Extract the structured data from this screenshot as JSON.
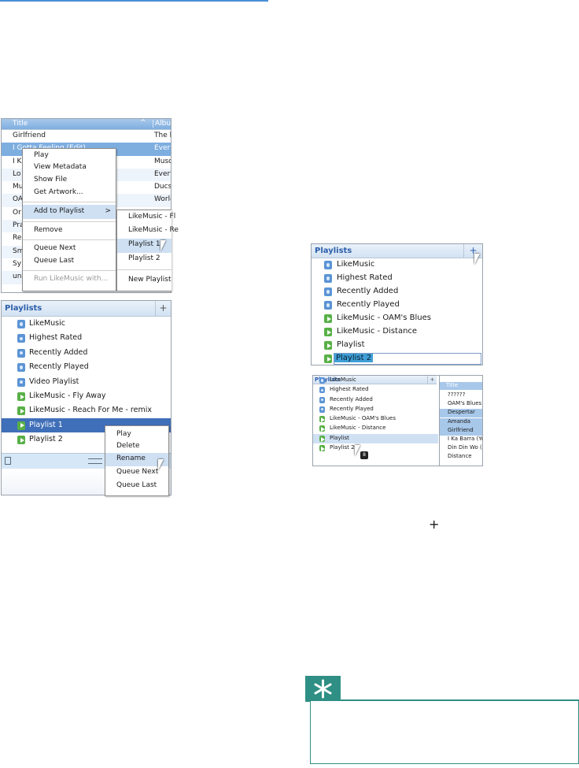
{
  "table_shot": {
    "header": {
      "title": "Title",
      "album": "Album"
    },
    "rows": [
      {
        "title": "Girlfriend",
        "album": "The b"
      },
      {
        "title": "I Gotta Feeling (Edit)",
        "album": "Every"
      },
      {
        "title": "I K",
        "album": "Muso"
      },
      {
        "title": "Lo",
        "album": "Every"
      },
      {
        "title": "Mu",
        "album": "Ducs"
      },
      {
        "title": "OA",
        "album": "World"
      },
      {
        "title": "Or",
        "album": ""
      },
      {
        "title": "Pra",
        "album": ""
      },
      {
        "title": "Re",
        "album": ""
      },
      {
        "title": "Sm",
        "album": ""
      },
      {
        "title": "Sy",
        "album": ""
      },
      {
        "title": "un",
        "album": ""
      }
    ],
    "context_menu": {
      "play": "Play",
      "view_metadata": "View Metadata",
      "show_file": "Show File",
      "get_artwork": "Get Artwork...",
      "add_to_playlist": "Add to Playlist",
      "remove": "Remove",
      "queue_next": "Queue Next",
      "queue_last": "Queue Last",
      "run_with": "Run LikeMusic with..."
    },
    "submenu": {
      "item1": "LikeMusic - Fl",
      "item2": "LikeMusic - Re",
      "item3": "Playlist 1",
      "item4": "Playlist 2",
      "new_playlist": "New Playlist"
    }
  },
  "playlists_shot": {
    "header": "Playlists",
    "plus": "+",
    "items": [
      "LikeMusic",
      "Highest Rated",
      "Recently Added",
      "Recently Played",
      "Video Playlist",
      "LikeMusic - Fly Away",
      "LikeMusic - Reach For Me - remix",
      "Playlist 1",
      "Playlist 2"
    ],
    "menu": {
      "play": "Play",
      "delete": "Delete",
      "rename": "Rename",
      "queue_next": "Queue Next",
      "queue_last": "Queue Last"
    }
  },
  "new_playlist_shot": {
    "header": "Playlists",
    "plus": "+",
    "items": [
      "LikeMusic",
      "Highest Rated",
      "Recently Added",
      "Recently Played",
      "LikeMusic - OAM's Blues",
      "LikeMusic - Distance",
      "Playlist"
    ],
    "edit_value": "Playlist 2"
  },
  "drag_shot": {
    "header": "Playlists",
    "plus": "+",
    "items": [
      "LikeMusic",
      "Highest Rated",
      "Recently Added",
      "Recently Played",
      "LikeMusic - OAM's Blues",
      "LikeMusic - Distance",
      "Playlist",
      "Playlist 2"
    ],
    "right_header": "Title",
    "right_items": [
      "??????",
      "OAM's Blues",
      "Despertar",
      "Amanda",
      "Girlfriend",
      "I Ka Barra (Yo",
      "Din Din Wo (",
      "Distance"
    ],
    "drag_count": "8"
  },
  "add_symbol": "+",
  "colors": {
    "accent": "#3f6fb8",
    "tip_green": "#2f8f84",
    "header_text": "#2b5eaa"
  }
}
